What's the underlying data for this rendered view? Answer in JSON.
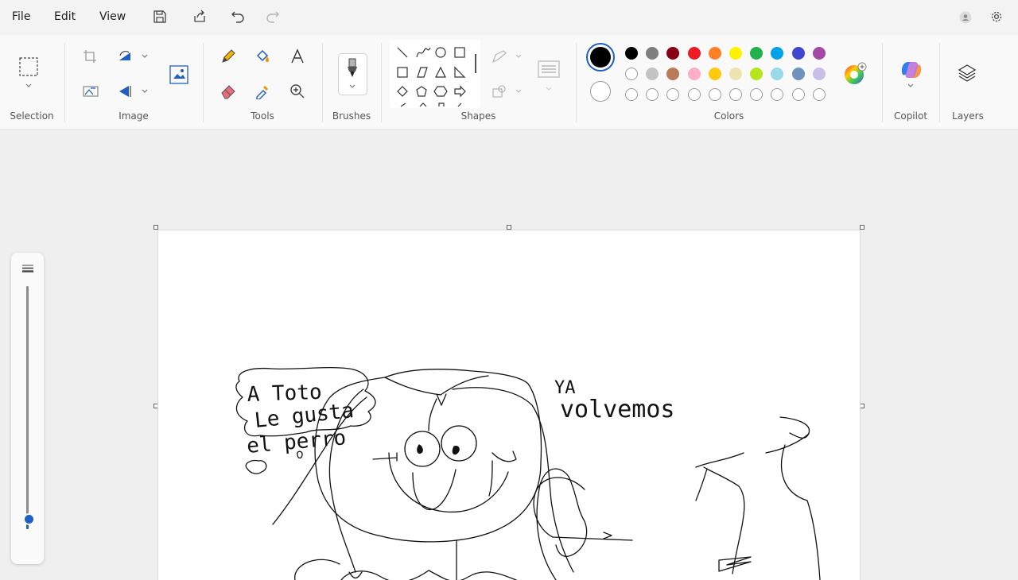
{
  "menu": {
    "file": "File",
    "edit": "Edit",
    "view": "View"
  },
  "groups": {
    "selection": "Selection",
    "image": "Image",
    "tools": "Tools",
    "brushes": "Brushes",
    "shapes": "Shapes",
    "colors": "Colors",
    "copilot": "Copilot",
    "layers": "Layers"
  },
  "colors": {
    "primary": "#000000",
    "secondary": "#ffffff",
    "row1": [
      "#000000",
      "#7f7f7f",
      "#880015",
      "#ed1c24",
      "#ff7f27",
      "#fff200",
      "#22b14c",
      "#00a2e8",
      "#3f48cc",
      "#a349a4"
    ],
    "row2": [
      "#ffffff",
      "#c3c3c3",
      "#b97a57",
      "#ffaec9",
      "#ffc90e",
      "#efe4b0",
      "#b5e61d",
      "#99d9ea",
      "#7092be",
      "#c8bfe7"
    ],
    "row3": [
      "",
      "",
      "",
      "",
      "",
      "",
      "",
      "",
      "",
      ""
    ]
  },
  "icons": [
    "save-icon",
    "share-icon",
    "undo-icon",
    "redo-icon",
    "account-icon",
    "gear-icon",
    "crop-icon",
    "rotate-icon",
    "flip-icon",
    "resize-icon",
    "pencil-icon",
    "fill-icon",
    "text-icon",
    "eraser-icon",
    "color-picker-icon",
    "magnifier-icon",
    "brush-icon",
    "color-wheel-icon",
    "copilot-icon",
    "layers-icon"
  ],
  "drawing": {
    "text1": "A Toto",
    "text2": "Le gusta",
    "text3": "el perro",
    "text4": "YA",
    "text5": "volvemos"
  },
  "zoom": {
    "level": 0.05
  }
}
